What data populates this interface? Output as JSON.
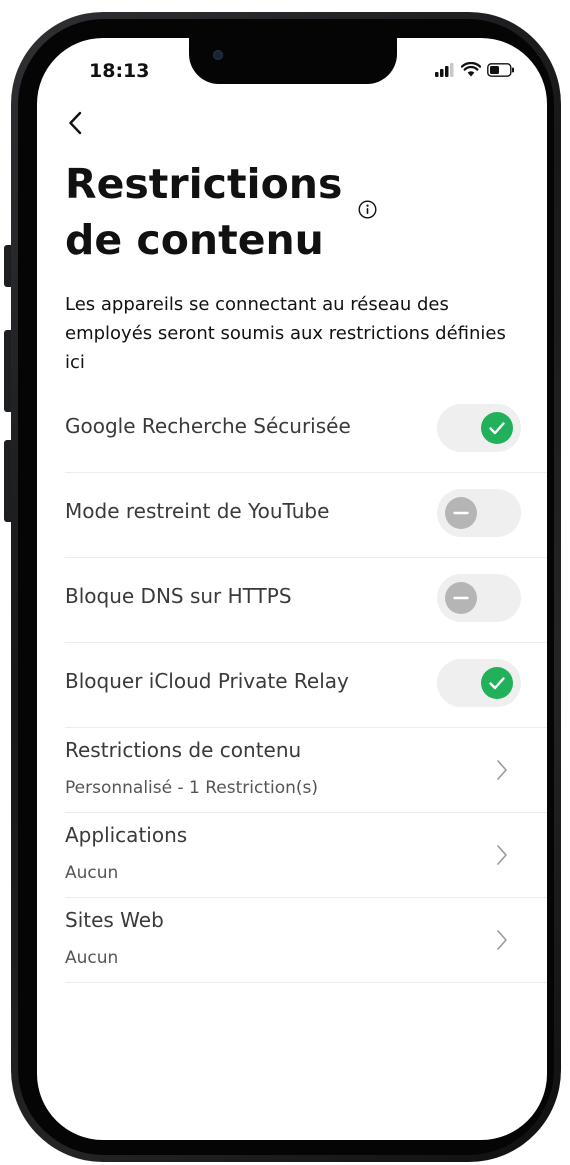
{
  "status_bar": {
    "time": "18:13",
    "icons": [
      "cellular-signal-icon",
      "wifi-icon",
      "battery-icon"
    ]
  },
  "header": {
    "back_icon": "chevron-left-icon",
    "title_line1": "Restrictions",
    "title_line2": "de contenu",
    "info_icon": "info-icon"
  },
  "description": "Les appareils se connectant au réseau des employés seront soumis aux restrictions définies ici",
  "toggles": [
    {
      "label": "Google Recherche Sécurisée",
      "enabled": true
    },
    {
      "label": "Mode restreint de YouTube",
      "enabled": false
    },
    {
      "label": "Bloque DNS sur HTTPS",
      "enabled": false
    },
    {
      "label": "Bloquer iCloud Private Relay",
      "enabled": true
    }
  ],
  "nav_items": [
    {
      "label": "Restrictions de contenu",
      "value": "Personnalisé - 1 Restriction(s)"
    },
    {
      "label": "Applications",
      "value": "Aucun"
    },
    {
      "label": "Sites Web",
      "value": "Aucun"
    }
  ],
  "colors": {
    "toggle_on": "#20b15a",
    "toggle_off": "#b5b5b5",
    "toggle_track": "#efefef",
    "text_primary": "#111111",
    "text_secondary": "#3a3a3a"
  }
}
